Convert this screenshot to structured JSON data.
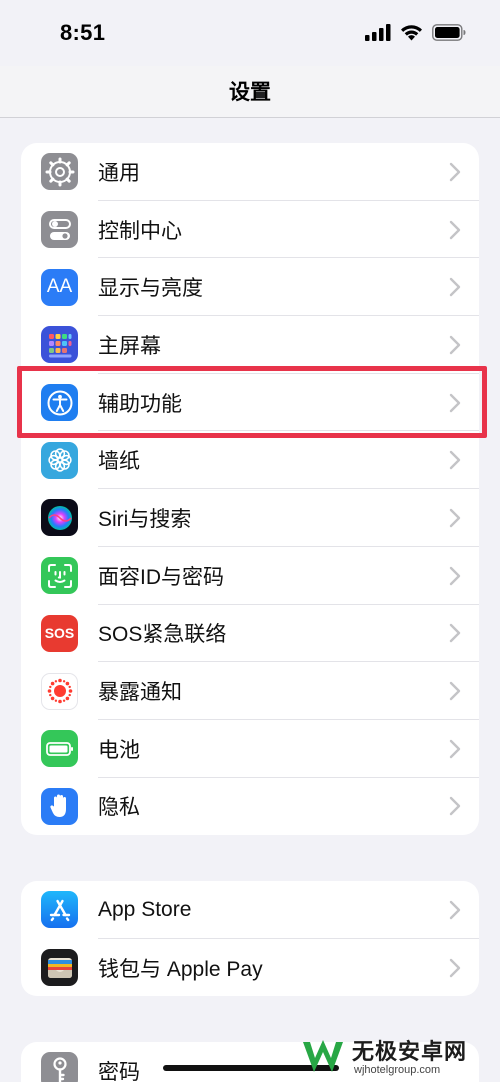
{
  "status_bar": {
    "time": "8:51"
  },
  "nav": {
    "title": "设置"
  },
  "groups": [
    {
      "rows": [
        {
          "label": "通用",
          "icon": "gear-icon",
          "color": "#8e8e93"
        },
        {
          "label": "控制中心",
          "icon": "toggles-icon",
          "color": "#8e8e93"
        },
        {
          "label": "显示与亮度",
          "icon": "aa-text-icon",
          "color": "#2b7cf6"
        },
        {
          "label": "主屏幕",
          "icon": "app-grid-icon",
          "color": "#3b52d9"
        },
        {
          "label": "辅助功能",
          "icon": "accessibility-icon",
          "color": "#1f7ef0"
        },
        {
          "label": "墙纸",
          "icon": "flower-icon",
          "color": "#36a7de"
        },
        {
          "label": "Siri与搜索",
          "icon": "siri-icon",
          "color": "#1a1a2e"
        },
        {
          "label": "面容ID与密码",
          "icon": "face-id-icon",
          "color": "#34c759"
        },
        {
          "label": "SOS紧急联络",
          "icon": "sos-icon",
          "color": "#e83a30",
          "icon_text": "SOS"
        },
        {
          "label": "暴露通知",
          "icon": "exposure-icon",
          "color": "#ffffff"
        },
        {
          "label": "电池",
          "icon": "battery-icon",
          "color": "#34c759"
        },
        {
          "label": "隐私",
          "icon": "hand-icon",
          "color": "#2b7cf6"
        }
      ]
    },
    {
      "rows": [
        {
          "label": "App Store",
          "icon": "app-store-icon",
          "color": "#1b8ef5"
        },
        {
          "label": "钱包与 Apple Pay",
          "icon": "wallet-icon",
          "color": "#1c1c1e"
        }
      ]
    },
    {
      "rows": [
        {
          "label": "密码",
          "icon": "key-icon",
          "color": "#8e8e93"
        }
      ]
    }
  ],
  "highlight": {
    "row": "辅助功能",
    "color": "#e8334a"
  },
  "watermark": {
    "main": "无极安卓网",
    "sub": "wjhotelgroup.com"
  }
}
